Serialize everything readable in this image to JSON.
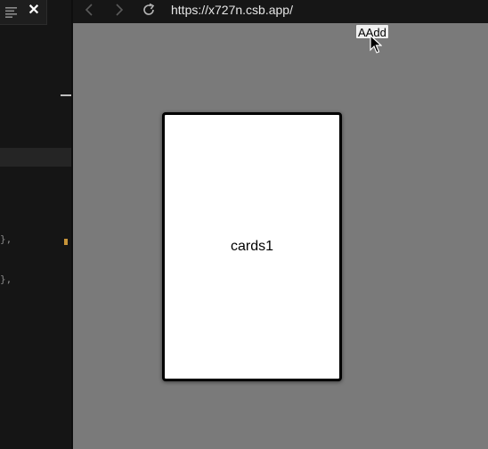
{
  "editor": {
    "code_lines": [
      "},",
      "},"
    ]
  },
  "browser": {
    "url": "https://x727n.csb.app/",
    "add_button_label": "AAdd",
    "card_label": "cards1"
  },
  "icons": {
    "list": "list-icon",
    "close": "close-icon",
    "back": "chevron-left-icon",
    "forward": "chevron-right-icon",
    "reload": "reload-icon",
    "cursor": "mouse-pointer-icon"
  },
  "colors": {
    "preview_background": "#7a7a7a",
    "editor_background": "#151515",
    "change_marker": "#c79439"
  }
}
